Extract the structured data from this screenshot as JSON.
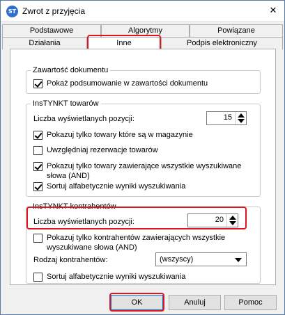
{
  "window": {
    "icon_text": "ST",
    "title": "Zwrot z przyjęcia",
    "close_glyph": "✕"
  },
  "tabs": {
    "row1": [
      "Podstawowe",
      "Algorytmy",
      "Powiązane"
    ],
    "row2": [
      "Działania",
      "Inne",
      "Podpis elektroniczny"
    ],
    "active": "Inne"
  },
  "doc_group": {
    "legend": "Zawartość dokumentu",
    "show_summary": {
      "label": "Pokaż podsumowanie w zawartości dokumentu",
      "checked": true
    }
  },
  "goods_group": {
    "legend": "InsTYNKT towarów",
    "count_label": "Liczba wyświetlanych pozycji:",
    "count_value": "15",
    "only_in_stock": {
      "label": "Pokazuj tylko towary które są w magazynie",
      "checked": true
    },
    "reservations": {
      "label": "Uwzględniaj rezerwacje towarów",
      "checked": false
    },
    "all_words": {
      "label_line1": "Pokazuj tylko towary zawierające wszystkie wyszukiwane",
      "label_line2": "słowa (AND)",
      "checked": true
    },
    "sort_alpha": {
      "label": "Sortuj alfabetycznie wyniki wyszukiwania",
      "checked": true
    }
  },
  "contractors_group": {
    "legend": "InsTYNKT kontrahentów",
    "count_label": "Liczba wyświetlanych pozycji:",
    "count_value": "20",
    "all_words": {
      "label_line1": "Pokazuj tylko kontrahentów zawierających wszystkie",
      "label_line2": "wyszukiwane słowa (AND)",
      "checked": false
    },
    "kind_label": "Rodzaj kontrahentów:",
    "kind_value": "(wszyscy)",
    "sort_alpha": {
      "label": "Sortuj alfabetycznie wyniki wyszukiwania",
      "checked": false
    }
  },
  "buttons": {
    "ok": "OK",
    "cancel": "Anuluj",
    "help": "Pomoc"
  },
  "colors": {
    "highlight": "#e0141e",
    "window_bg": "#f0f0f0",
    "accent": "#0078d7"
  }
}
